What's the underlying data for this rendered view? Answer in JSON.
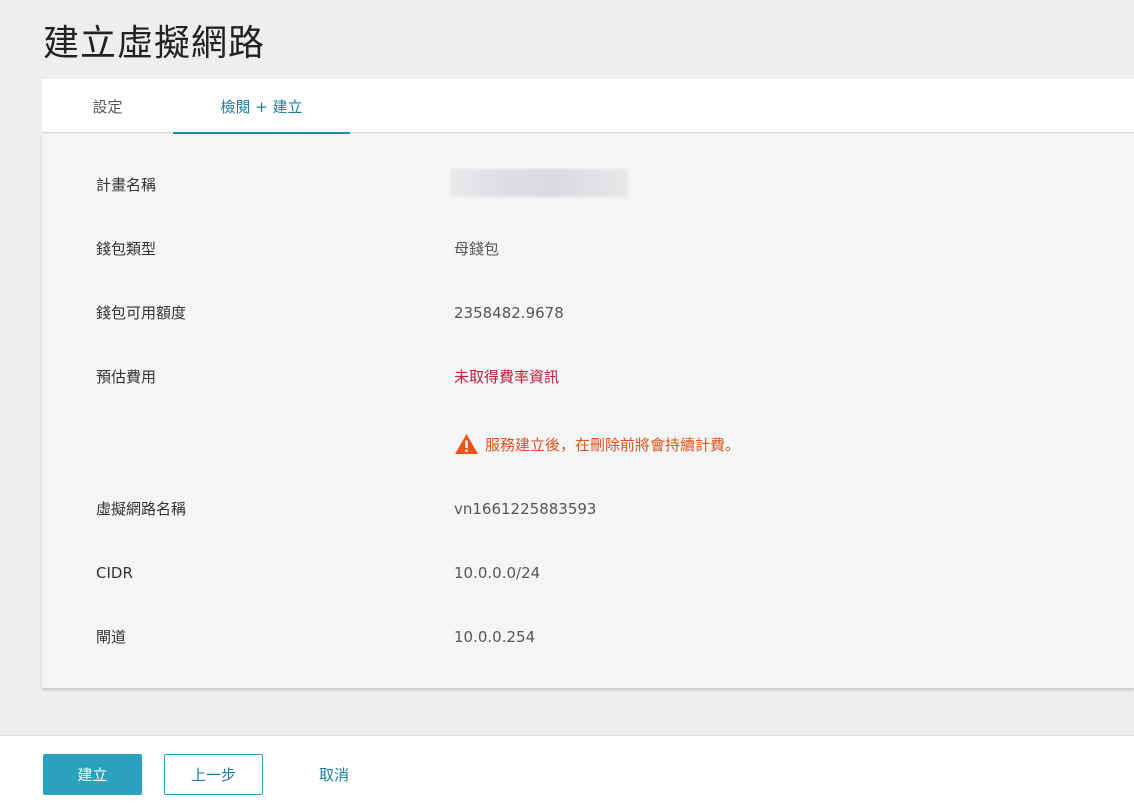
{
  "page": {
    "title": "建立虛擬網路"
  },
  "tabs": [
    {
      "label": "設定",
      "active": false
    },
    {
      "label": "檢閱 + 建立",
      "active": true
    }
  ],
  "review": {
    "rows": [
      {
        "label": "計畫名稱",
        "value": ""
      },
      {
        "label": "錢包類型",
        "value": "母錢包"
      },
      {
        "label": "錢包可用額度",
        "value": "2358482.9678"
      },
      {
        "label": "預估費用",
        "value": "未取得費率資訊"
      },
      {
        "label": "虛擬網路名稱",
        "value": "vn1661225883593"
      },
      {
        "label": "CIDR",
        "value": "10.0.0.0/24"
      },
      {
        "label": "閘道",
        "value": "10.0.0.254"
      }
    ],
    "warning_text": "服務建立後，在刪除前將會持續計費。",
    "warning_icon": "warning-triangle-icon"
  },
  "footer": {
    "create_label": "建立",
    "back_label": "上一步",
    "cancel_label": "取消"
  },
  "colors": {
    "accent": "#2ba1be",
    "error": "#c0203a",
    "warning": "#e0541c"
  }
}
